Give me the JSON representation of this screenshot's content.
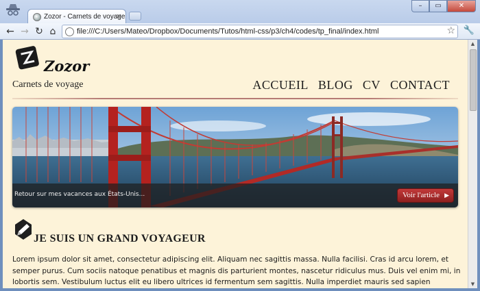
{
  "browser": {
    "tab_title": "Zozor - Carnets de voyage",
    "tab_close": "×",
    "url": "file:///C:/Users/Mateo/Dropbox/Documents/Tutos/html-css/p3/ch4/codes/tp_final/index.html",
    "back_icon": "←",
    "forward_icon": "→",
    "reload_icon": "↻",
    "home_icon": "⌂",
    "star_icon": "☆",
    "wrench_icon": "🔧",
    "minimize_icon": "–",
    "maximize_icon": "▭",
    "close_icon": "✕"
  },
  "site": {
    "name": "Zozor",
    "tagline": "Carnets de voyage",
    "nav": [
      "ACCUEIL",
      "BLOG",
      "CV",
      "CONTACT"
    ]
  },
  "banner": {
    "caption": "Retour sur mes vacances aux États-Unis...",
    "button_label": "Voir l'article",
    "button_arrow": "▶"
  },
  "article": {
    "title": "JE SUIS UN GRAND VOYAGEUR",
    "body": "Lorem ipsum dolor sit amet, consectetur adipiscing elit. Aliquam nec sagittis massa. Nulla facilisi. Cras id arcu lorem, et semper purus. Cum sociis natoque penatibus et magnis dis parturient montes, nascetur ridiculus mus. Duis vel enim mi, in lobortis sem. Vestibulum luctus elit eu libero ultrices id fermentum sem sagittis. Nulla imperdiet mauris sed sapien dignissim"
  },
  "scrollbar": {
    "up_icon": "▲",
    "down_icon": "▼"
  },
  "colors": {
    "page_background": "#fdf3d9",
    "accent_red": "#b02a2a",
    "header_rule": "#b57a74"
  }
}
